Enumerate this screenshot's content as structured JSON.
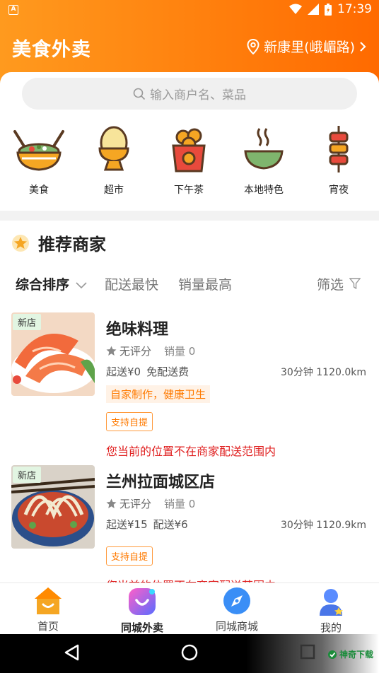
{
  "status_bar": {
    "time": "17:39",
    "app_badge": "A"
  },
  "header": {
    "title": "美食外卖",
    "location": "新康里(峨嵋路)"
  },
  "search": {
    "placeholder": "输入商户名、菜品"
  },
  "categories": [
    {
      "label": "美食",
      "icon": "salad-bowl-icon"
    },
    {
      "label": "超市",
      "icon": "egg-cup-icon"
    },
    {
      "label": "下午茶",
      "icon": "donut-bag-icon"
    },
    {
      "label": "本地特色",
      "icon": "soup-bowl-icon"
    },
    {
      "label": "宵夜",
      "icon": "skewer-icon"
    }
  ],
  "recommend": {
    "title": "推荐商家",
    "sort": {
      "comprehensive": "综合排序",
      "fastest": "配送最快",
      "top_sales": "销量最高",
      "filter": "筛选"
    }
  },
  "shops": [
    {
      "badge": "新店",
      "name": "绝味料理",
      "rating": "无评分",
      "sales": "销量 0",
      "min_order": "起送¥0",
      "delivery_fee": "免配送费",
      "distance": "30分钟 1120.0km",
      "tag": "自家制作，健康卫生",
      "pickup": "支持自提",
      "warning": "您当前的位置不在商家配送范围内"
    },
    {
      "badge": "新店",
      "name": "兰州拉面城区店",
      "rating": "无评分",
      "sales": "销量 0",
      "min_order": "起送¥15",
      "delivery_fee": "配送¥6",
      "distance": "30分钟 1120.9km",
      "pickup": "支持自提",
      "warning": "您当前的位置不在商家配送范围内"
    }
  ],
  "tabbar": {
    "home": "首页",
    "takeout": "同城外卖",
    "mall": "同城商城",
    "mine": "我的"
  },
  "watermark": "神奇下载",
  "colors": {
    "accent": "#ff7a00",
    "warning": "#e02020",
    "header_start": "#ff9a1e",
    "header_end": "#ff6a00"
  }
}
